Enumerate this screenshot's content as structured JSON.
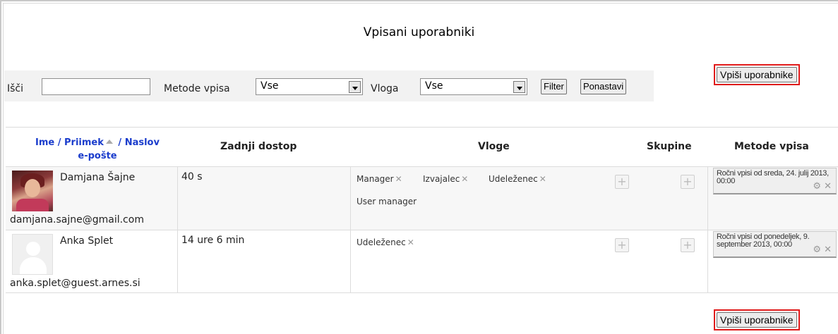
{
  "title": "Vpisani uporabniki",
  "filters": {
    "search_label": "Išči",
    "search_value": "",
    "method_label": "Metode vpisa",
    "method_value": "Vse",
    "role_label": "Vloga",
    "role_value": "Vse",
    "filter_button": "Filter",
    "reset_button": "Ponastavi"
  },
  "enroll_button": "Vpiši uporabnike",
  "table": {
    "headers": {
      "name_first": "Ime",
      "sep1": " / ",
      "name_last": "Priimek",
      "sep2": " / ",
      "email_a": "Naslov",
      "email_b": "e-pošte",
      "last_access": "Zadnji dostop",
      "roles": "Vloge",
      "groups": "Skupine",
      "methods": "Metode vpisa"
    },
    "rows": [
      {
        "name": "Damjana Šajne",
        "email": "damjana.sajne@gmail.com",
        "last_access": "40 s",
        "roles": [
          "Manager",
          "Izvajalec",
          "Udeleženec",
          "User manager"
        ],
        "method": "Ročni vpisi od sreda, 24. julij 2013, 00:00"
      },
      {
        "name": "Anka Splet",
        "email": "anka.splet@guest.arnes.si",
        "last_access": "14 ure 6 min",
        "roles": [
          "Udeleženec"
        ],
        "method": "Ročni vpisi od ponedeljek, 9. september 2013, 00:00"
      }
    ]
  },
  "icons": {
    "remove": "close-icon",
    "add": "plus-icon",
    "settings": "gear-icon",
    "sort_asc": "sort-up-icon"
  },
  "colors": {
    "highlight": "#e01a1a",
    "link": "#1a3ccc"
  }
}
